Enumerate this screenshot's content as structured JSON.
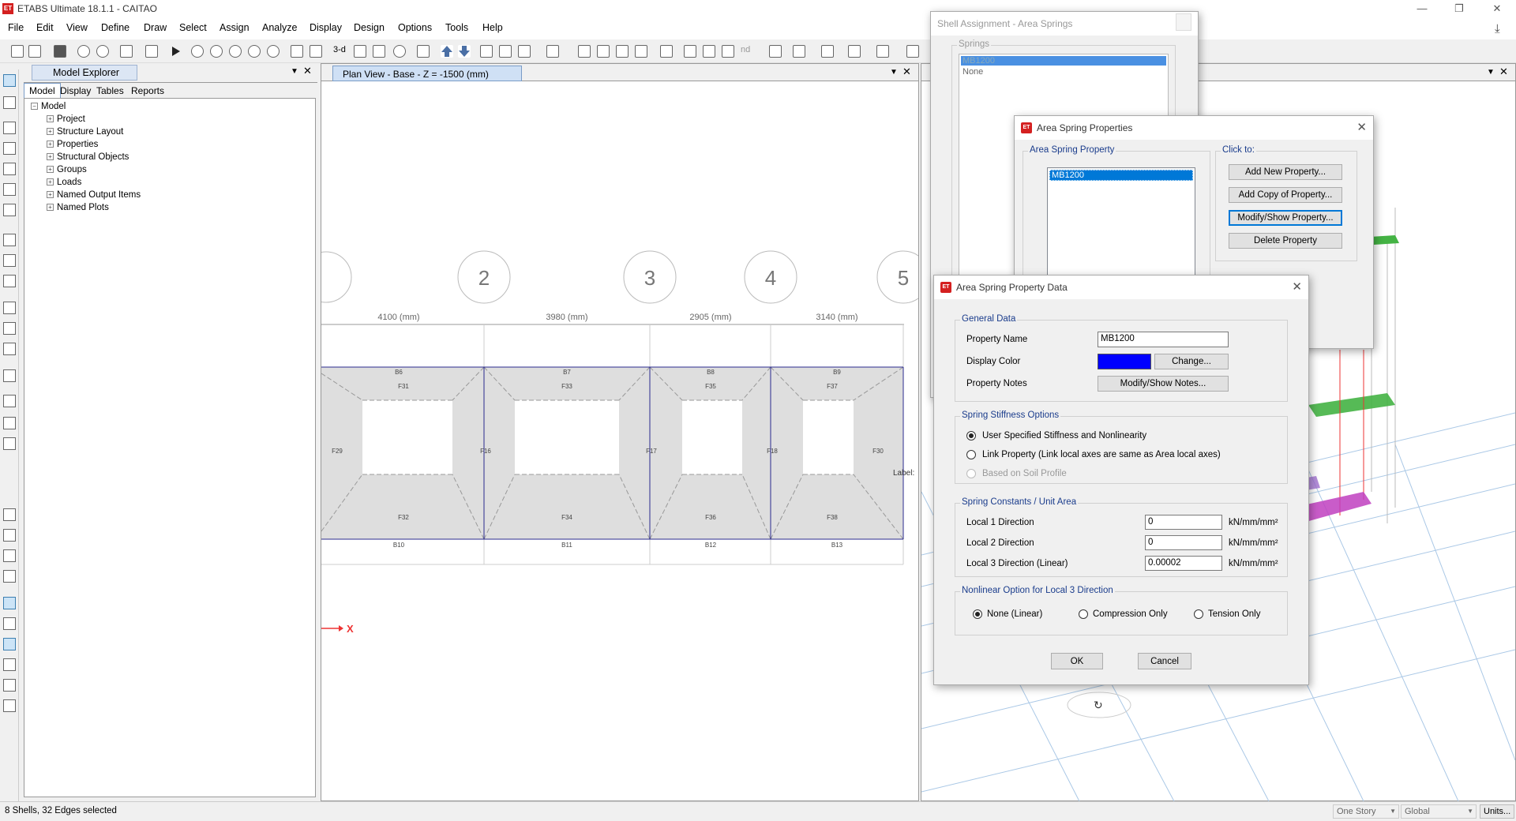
{
  "app": {
    "title": "ETABS Ultimate 18.1.1 - CAITAO",
    "logo": "ET"
  },
  "menu": [
    "File",
    "Edit",
    "View",
    "Define",
    "Draw",
    "Select",
    "Assign",
    "Analyze",
    "Display",
    "Design",
    "Options",
    "Tools",
    "Help"
  ],
  "explorer": {
    "title": "Model Explorer",
    "tabs": [
      "Model",
      "Display",
      "Tables",
      "Reports"
    ],
    "root": "Model",
    "items": [
      "Project",
      "Structure Layout",
      "Properties",
      "Structural Objects",
      "Groups",
      "Loads",
      "Named Output Items",
      "Named Plots"
    ]
  },
  "plan": {
    "tab": "Plan View - Base - Z = -1500 (mm)",
    "grid_labels": [
      "2",
      "3",
      "4",
      "5"
    ],
    "dims": [
      "4100 (mm)",
      "3980 (mm)",
      "2905 (mm)",
      "3140 (mm)"
    ],
    "beams_top": [
      "B6",
      "B7",
      "B8",
      "B9"
    ],
    "beams_bottom": [
      "B10",
      "B11",
      "B12",
      "B13"
    ],
    "shells_top": [
      "F31",
      "F33",
      "F35",
      "F37"
    ],
    "shells_bottom": [
      "F32",
      "F34",
      "F36",
      "F38"
    ],
    "shells_side": [
      "F29",
      "F16",
      "F17",
      "F18",
      "F30"
    ],
    "label_text": "Label:",
    "axis_x": "X"
  },
  "status": {
    "left": "8 Shells, 32 Edges selected",
    "story": "One Story",
    "coord": "Global",
    "units": "Units..."
  },
  "dlg_shell": {
    "title": "Shell Assignment - Area Springs",
    "group": "Springs",
    "items": [
      "MB1200",
      "None"
    ]
  },
  "dlg_props": {
    "title": "Area Spring Properties",
    "group": "Area Spring Property",
    "items": [
      "MB1200"
    ],
    "clickto": "Click to:",
    "buttons": [
      "Add New Property...",
      "Add Copy of Property...",
      "Modify/Show Property...",
      "Delete Property"
    ]
  },
  "dlg_data": {
    "title": "Area Spring Property Data",
    "general": {
      "label": "General Data",
      "name_label": "Property Name",
      "name_value": "MB1200",
      "color_label": "Display Color",
      "color": "#0000ff",
      "change": "Change...",
      "notes_label": "Property Notes",
      "notes_btn": "Modify/Show Notes..."
    },
    "stiff": {
      "label": "Spring Stiffness Options",
      "opt1": "User Specified Stiffness and Nonlinearity",
      "opt2": "Link Property (Link local axes are same as Area local axes)",
      "opt3": "Based on Soil Profile"
    },
    "consts": {
      "label": "Spring Constants / Unit Area",
      "rows": [
        {
          "label": "Local 1 Direction",
          "value": "0",
          "unit": "kN/mm/mm²"
        },
        {
          "label": "Local 2 Direction",
          "value": "0",
          "unit": "kN/mm/mm²"
        },
        {
          "label": "Local 3 Direction  (Linear)",
          "value": "0.00002",
          "unit": "kN/mm/mm²"
        }
      ]
    },
    "nonlin": {
      "label": "Nonlinear Option for Local 3 Direction",
      "opts": [
        "None (Linear)",
        "Compression Only",
        "Tension Only"
      ]
    },
    "ok": "OK",
    "cancel": "Cancel"
  },
  "colors": {
    "spring_display": "#0000ff",
    "accent": "#0078d7"
  }
}
